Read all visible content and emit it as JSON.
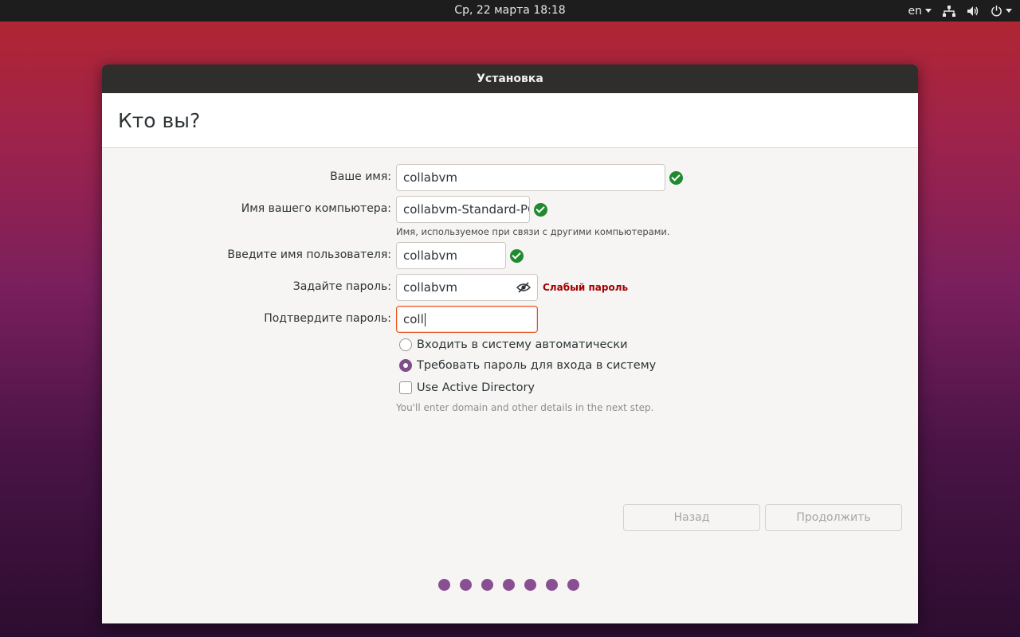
{
  "topbar": {
    "clock": "Ср, 22 марта  18:18",
    "language": "en",
    "icons": [
      "network-icon",
      "volume-icon",
      "power-icon"
    ]
  },
  "window": {
    "title": "Установка",
    "heading": "Кто вы?"
  },
  "form": {
    "name_label": "Ваше имя:",
    "name_value": "collabvm",
    "computer_label": "Имя вашего компьютера:",
    "computer_value": "collabvm-Standard-PC-",
    "computer_hint": "Имя, используемое при связи с другими компьютерами.",
    "username_label": "Введите имя пользователя:",
    "username_value": "collabvm",
    "password_label": "Задайте пароль:",
    "password_value": "collabvm",
    "password_strength": "Слабый пароль",
    "confirm_label": "Подтвердите пароль:",
    "confirm_value": "coll",
    "auto_login_label": "Входить в систему автоматически",
    "require_password_label": "Требовать пароль для входа в систему",
    "ad_label": "Use Active Directory",
    "ad_hint": "You'll enter domain and other details in the next step."
  },
  "buttons": {
    "back": "Назад",
    "continue": "Продолжить"
  },
  "progress": {
    "steps": 7
  },
  "colors": {
    "accent": "#e95420",
    "ok": "#1f8a2f",
    "weak": "#a40000",
    "step_dot": "#8a4f92"
  }
}
